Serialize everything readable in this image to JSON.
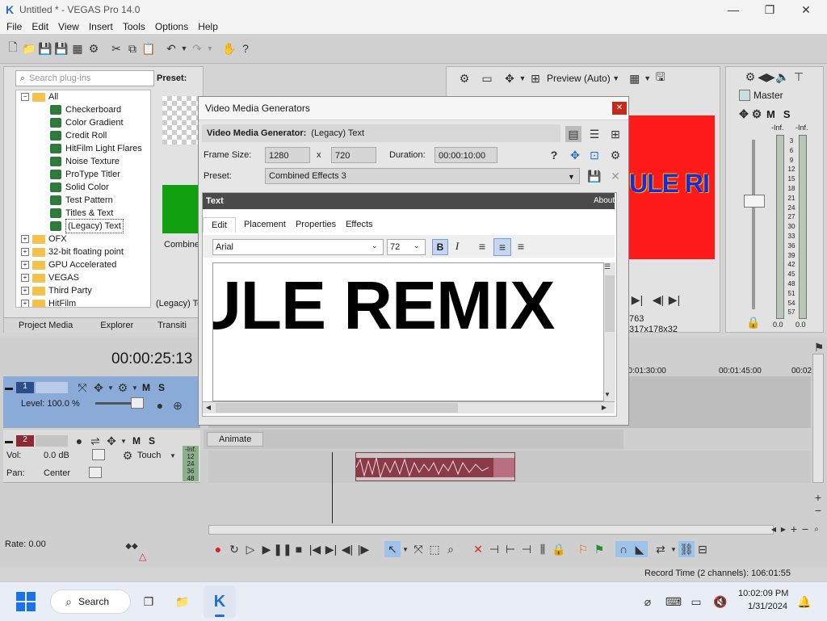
{
  "window": {
    "title": "Untitled * - VEGAS Pro 14.0"
  },
  "menu": [
    "File",
    "Edit",
    "View",
    "Insert",
    "Tools",
    "Options",
    "Help"
  ],
  "toolbar": {
    "preview_mode": "Preview (Auto)"
  },
  "plugins": {
    "search_placeholder": "Search plug-ins",
    "preset_label": "Preset:",
    "root": "All",
    "items": [
      "Checkerboard",
      "Color Gradient",
      "Credit Roll",
      "HitFilm Light Flares",
      "Noise Texture",
      "ProType Titler",
      "Solid Color",
      "Test Pattern",
      "Titles & Text",
      "(Legacy) Text"
    ],
    "folders": [
      "OFX",
      "32-bit floating point",
      "GPU Accelerated",
      "VEGAS",
      "Third Party",
      "HitFilm"
    ],
    "preset_caption": "Combined",
    "preset_caption2": "(Legacy) Te",
    "tabs": [
      "Project Media",
      "Explorer",
      "Transiti"
    ]
  },
  "preview": {
    "text_fragment": "ULE RI",
    "info1": "763",
    "info2": "317x178x32"
  },
  "master": {
    "label": "Master",
    "left_inf": "-Inf.",
    "right_inf": "-Inf.",
    "scale": [
      "3",
      "6",
      "9",
      "12",
      "15",
      "18",
      "21",
      "24",
      "27",
      "30",
      "33",
      "36",
      "39",
      "42",
      "45",
      "48",
      "51",
      "54",
      "57"
    ],
    "left_val": "0.0",
    "right_val": "0.0"
  },
  "dialog": {
    "title": "Video Media Generators",
    "generator_label": "Video Media Generator:",
    "generator_value": "(Legacy) Text",
    "frame_size_label": "Frame Size:",
    "frame_w": "1280",
    "x_label": "x",
    "frame_h": "720",
    "duration_label": "Duration:",
    "duration_value": "00:00:10:00",
    "preset_label": "Preset:",
    "preset_value": "Combined Effects 3",
    "text_header": "Text",
    "about": "About",
    "tabs": [
      "Edit",
      "Placement",
      "Properties",
      "Effects"
    ],
    "font": "Arial",
    "size": "72",
    "bold": "B",
    "italic": "I",
    "editor_text": "ULE REMIX",
    "animate": "Animate"
  },
  "timeline": {
    "timecode": "00:00:25:13",
    "track1_num": "1",
    "track1_level": "Level: 100.0 %",
    "track2_num": "2",
    "vol_label": "Vol:",
    "vol_value": "0.0 dB",
    "touch": "Touch",
    "pan_label": "Pan:",
    "pan_value": "Center",
    "meter": [
      "-Inf.",
      "12",
      "24",
      "36",
      "48"
    ],
    "ruler": [
      "00:01:30:00",
      "00:01:45:00",
      "00:02"
    ],
    "m": "M",
    "s": "S",
    "rate": "Rate: 0.00",
    "record_time": "Record Time (2 channels): 106:01:55"
  },
  "taskbar": {
    "search": "Search",
    "time": "10:02:09 PM",
    "date": "1/31/2024"
  },
  "colors": {
    "accent": "#1f6fd0",
    "track1": "#8aaad8",
    "red_preview": "#ff1a1a",
    "waveform": "#8b3a48"
  }
}
